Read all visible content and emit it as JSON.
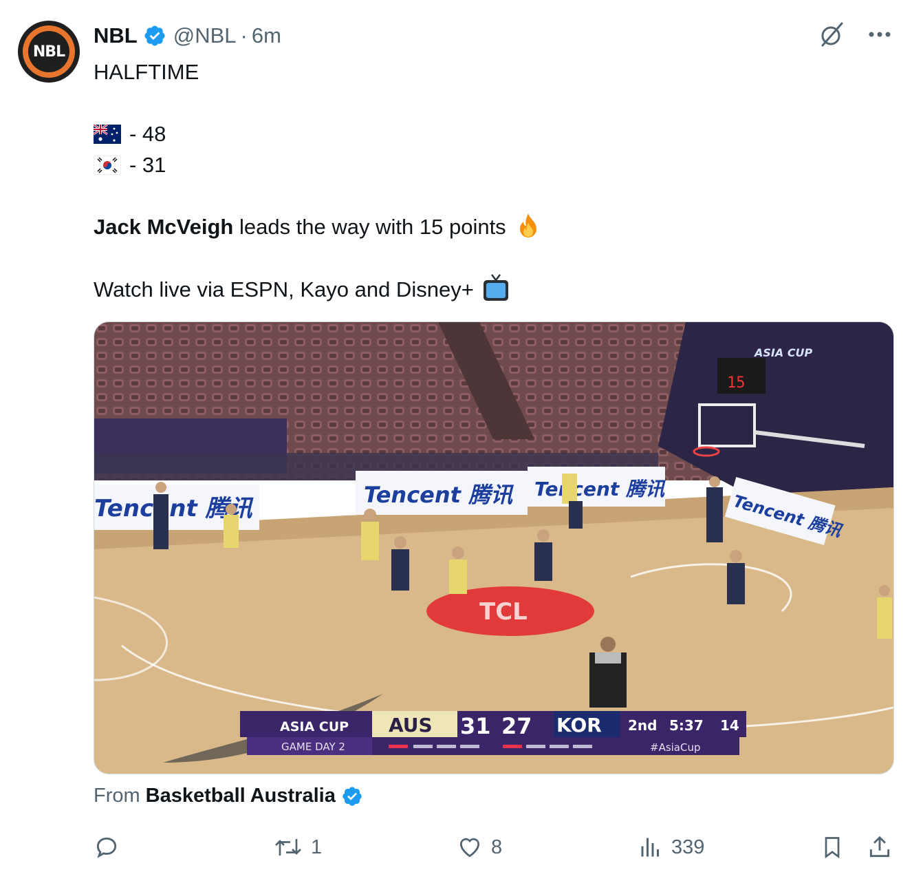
{
  "author": {
    "avatar_text": "NBL",
    "name": "NBL",
    "handle": "@NBL",
    "separator": "·",
    "time": "6m"
  },
  "tweet": {
    "line1": "HALFTIME",
    "score_aus": "- 48",
    "score_kor": "- 31",
    "player_name": "Jack McVeigh",
    "player_text": " leads the way with 15 points",
    "watch_text": "Watch live via ESPN, Kayo and Disney+"
  },
  "media": {
    "ads": [
      "Tencent 腾讯",
      "Tencent 腾讯",
      "Tencent 腾讯",
      "Tencent 腾讯"
    ],
    "court_logo": "TCL",
    "arena_banner": "ASIA CUP",
    "scorebug": {
      "tournament": "ASIA CUP",
      "subtitle": "GAME DAY 2",
      "team_home": "AUS",
      "score_home": "31",
      "score_away": "27",
      "team_away": "KOR",
      "period": "2nd",
      "clock": "5:37",
      "shot_clock": "14",
      "hashtag": "#AsiaCup"
    },
    "shot_clock_display": "15"
  },
  "from": {
    "label": "From",
    "source": "Basketball Australia"
  },
  "actions": {
    "retweets": "1",
    "likes": "8",
    "views": "339"
  },
  "colors": {
    "accent": "#1d9bf0",
    "muted": "#536471",
    "text": "#0f1419",
    "court": "#d9b98a",
    "purple": "#3b2466"
  },
  "icons": [
    "verified-icon",
    "grok-icon",
    "more-icon",
    "australia-flag-icon",
    "korea-flag-icon",
    "fire-icon",
    "tv-icon",
    "reply-icon",
    "retweet-icon",
    "like-icon",
    "views-icon",
    "bookmark-icon",
    "share-icon"
  ]
}
